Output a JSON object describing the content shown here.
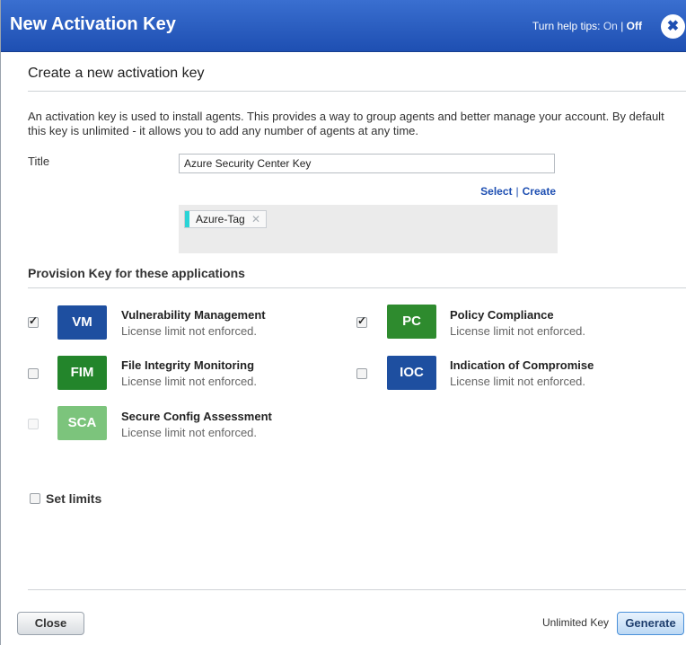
{
  "dialog": {
    "title": "New Activation Key",
    "help_prefix": "Turn help tips:",
    "help_on": "On",
    "help_sep": "|",
    "help_off": "Off"
  },
  "section": {
    "title": "Create a new activation key",
    "description": "An activation key is used to install agents. This provides a way to group agents and better manage your account. By default this key is unlimited - it allows you to add any number of agents at any time."
  },
  "form": {
    "title_label": "Title",
    "title_value": "Azure Security Center Key",
    "select_link": "Select",
    "link_sep": "|",
    "create_link": "Create",
    "tags": [
      {
        "label": "Azure-Tag",
        "color": "#2ad4d6"
      }
    ]
  },
  "provision": {
    "title": "Provision Key for these applications",
    "apps": [
      {
        "code": "VM",
        "name": "Vulnerability Management",
        "limit": "License limit not enforced.",
        "checked": true,
        "enabled": true,
        "color": "#1e4fa0"
      },
      {
        "code": "PC",
        "name": "Policy Compliance",
        "limit": "License limit not enforced.",
        "checked": true,
        "enabled": true,
        "color": "#2e8b2e"
      },
      {
        "code": "FIM",
        "name": "File Integrity Monitoring",
        "limit": "License limit not enforced.",
        "checked": false,
        "enabled": true,
        "color": "#23852b"
      },
      {
        "code": "IOC",
        "name": "Indication of Compromise",
        "limit": "License limit not enforced.",
        "checked": false,
        "enabled": true,
        "color": "#1e4fa0"
      },
      {
        "code": "SCA",
        "name": "Secure Config Assessment",
        "limit": "License limit not enforced.",
        "checked": false,
        "enabled": false,
        "color": "#7cc47c"
      }
    ]
  },
  "limits": {
    "label": "Set limits",
    "checked": false
  },
  "footer": {
    "close_label": "Close",
    "key_status": "Unlimited Key",
    "generate_label": "Generate"
  }
}
